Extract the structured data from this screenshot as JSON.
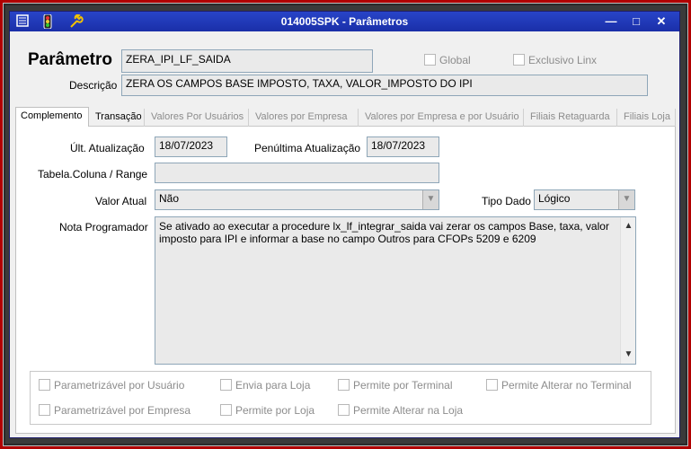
{
  "window": {
    "title": "014005SPK - Parâmetros",
    "minimize": "—",
    "maximize": "□",
    "close": "✕"
  },
  "header": {
    "parametro_label": "Parâmetro",
    "parametro_value": "ZERA_IPI_LF_SAIDA",
    "descricao_label": "Descrição",
    "descricao_value": "ZERA OS CAMPOS BASE IMPOSTO, TAXA, VALOR_IMPOSTO DO IPI",
    "global_label": "Global",
    "exclusivo_label": "Exclusivo Linx"
  },
  "tabs": [
    {
      "label": "Complemento"
    },
    {
      "label": "Transação"
    },
    {
      "label": "Valores Por Usuários"
    },
    {
      "label": "Valores por Empresa"
    },
    {
      "label": "Valores por Empresa e por Usuário"
    },
    {
      "label": "Filiais Retaguarda"
    },
    {
      "label": "Filiais Loja"
    }
  ],
  "form": {
    "ult_atualizacao_label": "Últ. Atualização",
    "ult_atualizacao_value": "18/07/2023",
    "penultima_label": "Penúltima Atualização",
    "penultima_value": "18/07/2023",
    "tabela_label": "Tabela.Coluna / Range",
    "tabela_value": "",
    "valor_atual_label": "Valor Atual",
    "valor_atual_value": "Não",
    "tipo_dado_label": "Tipo Dado",
    "tipo_dado_value": "Lógico",
    "nota_label": "Nota Programador",
    "nota_value": "Se ativado ao executar a procedure lx_lf_integrar_saida vai zerar os campos Base, taxa, valor imposto para IPI e informar a base no campo Outros para CFOPs 5209 e 6209"
  },
  "options": {
    "param_usuario": "Parametrizável por Usuário",
    "envia_loja": "Envia para Loja",
    "permite_terminal": "Permite por Terminal",
    "permite_alterar_terminal": "Permite Alterar no Terminal",
    "param_empresa": "Parametrizável por Empresa",
    "permite_loja": "Permite por Loja",
    "permite_alterar_loja": "Permite Alterar na Loja"
  },
  "colors": {
    "titlebar": "#2844c8",
    "frame": "#b00000"
  },
  "icons": [
    "menu-icon",
    "traffic-light-icon",
    "wrench-icon",
    "chevron-down-icon",
    "scroll-up-icon",
    "scroll-down-icon"
  ]
}
